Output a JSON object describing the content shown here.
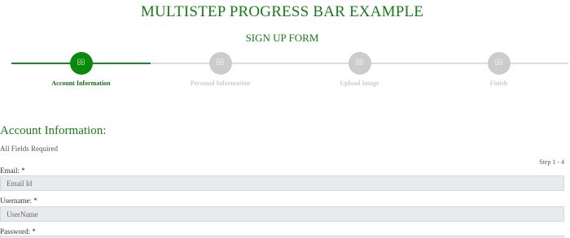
{
  "header": {
    "title": "MULTISTEP PROGRESS BAR EXAMPLE",
    "subtitle": "SIGN UP FORM"
  },
  "progress": {
    "steps": [
      {
        "label": "Account Information",
        "icon": "user-icon",
        "active": true
      },
      {
        "label": "Personal Information",
        "icon": "id-card-icon",
        "active": false
      },
      {
        "label": "Upload Image",
        "icon": "image-icon",
        "active": false
      },
      {
        "label": "Finish",
        "icon": "check-icon",
        "active": false
      }
    ],
    "icon_glyph": "",
    "active_color": "#0a8a0a",
    "inactive_color": "#cccccc"
  },
  "form": {
    "section_title": "Account Information:",
    "required_note": "All Fields Required",
    "step_counter": "Step 1 - 4",
    "fields": [
      {
        "label": "Email: *",
        "placeholder": "Email Id",
        "value": ""
      },
      {
        "label": "Username: *",
        "placeholder": "UserName",
        "value": ""
      },
      {
        "label": "Password: *",
        "placeholder": "",
        "value": ""
      }
    ]
  },
  "colors": {
    "accent": "#1a7a1a",
    "input_bg": "#e8ebee"
  }
}
